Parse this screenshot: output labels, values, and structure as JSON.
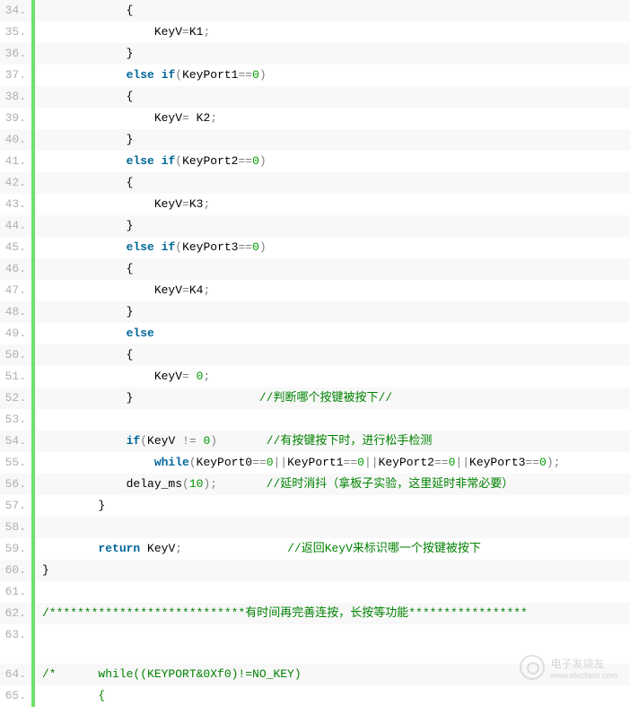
{
  "watermark": {
    "title": "电子发烧友",
    "url": "www.elecfans.com"
  },
  "lines": [
    {
      "n": "34.",
      "seg": [
        {
          "t": "            {",
          "c": "plain"
        }
      ]
    },
    {
      "n": "35.",
      "seg": [
        {
          "t": "                KeyV",
          "c": "plain"
        },
        {
          "t": "=",
          "c": "op"
        },
        {
          "t": "K1",
          "c": "plain"
        },
        {
          "t": ";",
          "c": "op"
        }
      ]
    },
    {
      "n": "36.",
      "seg": [
        {
          "t": "            }",
          "c": "plain"
        }
      ]
    },
    {
      "n": "37.",
      "seg": [
        {
          "t": "            ",
          "c": "plain"
        },
        {
          "t": "else",
          "c": "kw"
        },
        {
          "t": " ",
          "c": "plain"
        },
        {
          "t": "if",
          "c": "kw"
        },
        {
          "t": "(",
          "c": "op"
        },
        {
          "t": "KeyPort1",
          "c": "plain"
        },
        {
          "t": "==",
          "c": "op"
        },
        {
          "t": "0",
          "c": "num"
        },
        {
          "t": ")",
          "c": "op"
        }
      ]
    },
    {
      "n": "38.",
      "seg": [
        {
          "t": "            {",
          "c": "plain"
        }
      ]
    },
    {
      "n": "39.",
      "seg": [
        {
          "t": "                KeyV",
          "c": "plain"
        },
        {
          "t": "=",
          "c": "op"
        },
        {
          "t": " K2",
          "c": "plain"
        },
        {
          "t": ";",
          "c": "op"
        }
      ]
    },
    {
      "n": "40.",
      "seg": [
        {
          "t": "            }",
          "c": "plain"
        }
      ]
    },
    {
      "n": "41.",
      "seg": [
        {
          "t": "            ",
          "c": "plain"
        },
        {
          "t": "else",
          "c": "kw"
        },
        {
          "t": " ",
          "c": "plain"
        },
        {
          "t": "if",
          "c": "kw"
        },
        {
          "t": "(",
          "c": "op"
        },
        {
          "t": "KeyPort2",
          "c": "plain"
        },
        {
          "t": "==",
          "c": "op"
        },
        {
          "t": "0",
          "c": "num"
        },
        {
          "t": ")",
          "c": "op"
        }
      ]
    },
    {
      "n": "42.",
      "seg": [
        {
          "t": "            {",
          "c": "plain"
        }
      ]
    },
    {
      "n": "43.",
      "seg": [
        {
          "t": "                KeyV",
          "c": "plain"
        },
        {
          "t": "=",
          "c": "op"
        },
        {
          "t": "K3",
          "c": "plain"
        },
        {
          "t": ";",
          "c": "op"
        }
      ]
    },
    {
      "n": "44.",
      "seg": [
        {
          "t": "            }",
          "c": "plain"
        }
      ]
    },
    {
      "n": "45.",
      "seg": [
        {
          "t": "            ",
          "c": "plain"
        },
        {
          "t": "else",
          "c": "kw"
        },
        {
          "t": " ",
          "c": "plain"
        },
        {
          "t": "if",
          "c": "kw"
        },
        {
          "t": "(",
          "c": "op"
        },
        {
          "t": "KeyPort3",
          "c": "plain"
        },
        {
          "t": "==",
          "c": "op"
        },
        {
          "t": "0",
          "c": "num"
        },
        {
          "t": ")",
          "c": "op"
        }
      ]
    },
    {
      "n": "46.",
      "seg": [
        {
          "t": "            {",
          "c": "plain"
        }
      ]
    },
    {
      "n": "47.",
      "seg": [
        {
          "t": "                KeyV",
          "c": "plain"
        },
        {
          "t": "=",
          "c": "op"
        },
        {
          "t": "K4",
          "c": "plain"
        },
        {
          "t": ";",
          "c": "op"
        }
      ]
    },
    {
      "n": "48.",
      "seg": [
        {
          "t": "            }",
          "c": "plain"
        }
      ]
    },
    {
      "n": "49.",
      "seg": [
        {
          "t": "            ",
          "c": "plain"
        },
        {
          "t": "else",
          "c": "kw"
        }
      ]
    },
    {
      "n": "50.",
      "seg": [
        {
          "t": "            {",
          "c": "plain"
        }
      ]
    },
    {
      "n": "51.",
      "seg": [
        {
          "t": "                KeyV",
          "c": "plain"
        },
        {
          "t": "=",
          "c": "op"
        },
        {
          "t": " ",
          "c": "plain"
        },
        {
          "t": "0",
          "c": "num"
        },
        {
          "t": ";",
          "c": "op"
        }
      ]
    },
    {
      "n": "52.",
      "seg": [
        {
          "t": "            }                  ",
          "c": "plain"
        },
        {
          "t": "//判断哪个按键被按下//",
          "c": "cmt"
        }
      ]
    },
    {
      "n": "53.",
      "seg": [
        {
          "t": " ",
          "c": "plain"
        }
      ]
    },
    {
      "n": "54.",
      "seg": [
        {
          "t": "            ",
          "c": "plain"
        },
        {
          "t": "if",
          "c": "kw"
        },
        {
          "t": "(",
          "c": "op"
        },
        {
          "t": "KeyV ",
          "c": "plain"
        },
        {
          "t": "!=",
          "c": "op"
        },
        {
          "t": " ",
          "c": "plain"
        },
        {
          "t": "0",
          "c": "num"
        },
        {
          "t": ")",
          "c": "op"
        },
        {
          "t": "       ",
          "c": "plain"
        },
        {
          "t": "//有按键按下时，进行松手检测",
          "c": "cmt"
        }
      ]
    },
    {
      "n": "55.",
      "seg": [
        {
          "t": "                ",
          "c": "plain"
        },
        {
          "t": "while",
          "c": "kw"
        },
        {
          "t": "(",
          "c": "op"
        },
        {
          "t": "KeyPort0",
          "c": "plain"
        },
        {
          "t": "==",
          "c": "op"
        },
        {
          "t": "0",
          "c": "num"
        },
        {
          "t": "||",
          "c": "op"
        },
        {
          "t": "KeyPort1",
          "c": "plain"
        },
        {
          "t": "==",
          "c": "op"
        },
        {
          "t": "0",
          "c": "num"
        },
        {
          "t": "||",
          "c": "op"
        },
        {
          "t": "KeyPort2",
          "c": "plain"
        },
        {
          "t": "==",
          "c": "op"
        },
        {
          "t": "0",
          "c": "num"
        },
        {
          "t": "||",
          "c": "op"
        },
        {
          "t": "KeyPort3",
          "c": "plain"
        },
        {
          "t": "==",
          "c": "op"
        },
        {
          "t": "0",
          "c": "num"
        },
        {
          "t": ");",
          "c": "op"
        }
      ]
    },
    {
      "n": "56.",
      "seg": [
        {
          "t": "            delay_ms",
          "c": "plain"
        },
        {
          "t": "(",
          "c": "op"
        },
        {
          "t": "10",
          "c": "num"
        },
        {
          "t": ");",
          "c": "op"
        },
        {
          "t": "       ",
          "c": "plain"
        },
        {
          "t": "//延时消抖（拿板子实验，这里延时非常必要）",
          "c": "cmt"
        }
      ]
    },
    {
      "n": "57.",
      "seg": [
        {
          "t": "        }",
          "c": "plain"
        }
      ]
    },
    {
      "n": "58.",
      "seg": [
        {
          "t": " ",
          "c": "plain"
        }
      ]
    },
    {
      "n": "59.",
      "seg": [
        {
          "t": "        ",
          "c": "plain"
        },
        {
          "t": "return",
          "c": "kw"
        },
        {
          "t": " KeyV",
          "c": "plain"
        },
        {
          "t": ";",
          "c": "op"
        },
        {
          "t": "               ",
          "c": "plain"
        },
        {
          "t": "//返回KeyV来标识哪一个按键被按下",
          "c": "cmt"
        }
      ]
    },
    {
      "n": "60.",
      "seg": [
        {
          "t": "}",
          "c": "plain"
        }
      ]
    },
    {
      "n": "61.",
      "seg": [
        {
          "t": " ",
          "c": "plain"
        }
      ]
    },
    {
      "n": "62.",
      "seg": [
        {
          "t": "/****************************有时间再完善连按，长按等功能*****************",
          "c": "cmt"
        }
      ]
    },
    {
      "n": "63.",
      "seg": [
        {
          "t": " ",
          "c": "plain"
        }
      ],
      "tall": true
    },
    {
      "n": "64.",
      "seg": [
        {
          "t": "/*      while((KEYPORT&0Xf0)!=NO_KEY)",
          "c": "cmt"
        }
      ]
    },
    {
      "n": "65.",
      "seg": [
        {
          "t": "        {",
          "c": "cmt"
        }
      ]
    }
  ]
}
